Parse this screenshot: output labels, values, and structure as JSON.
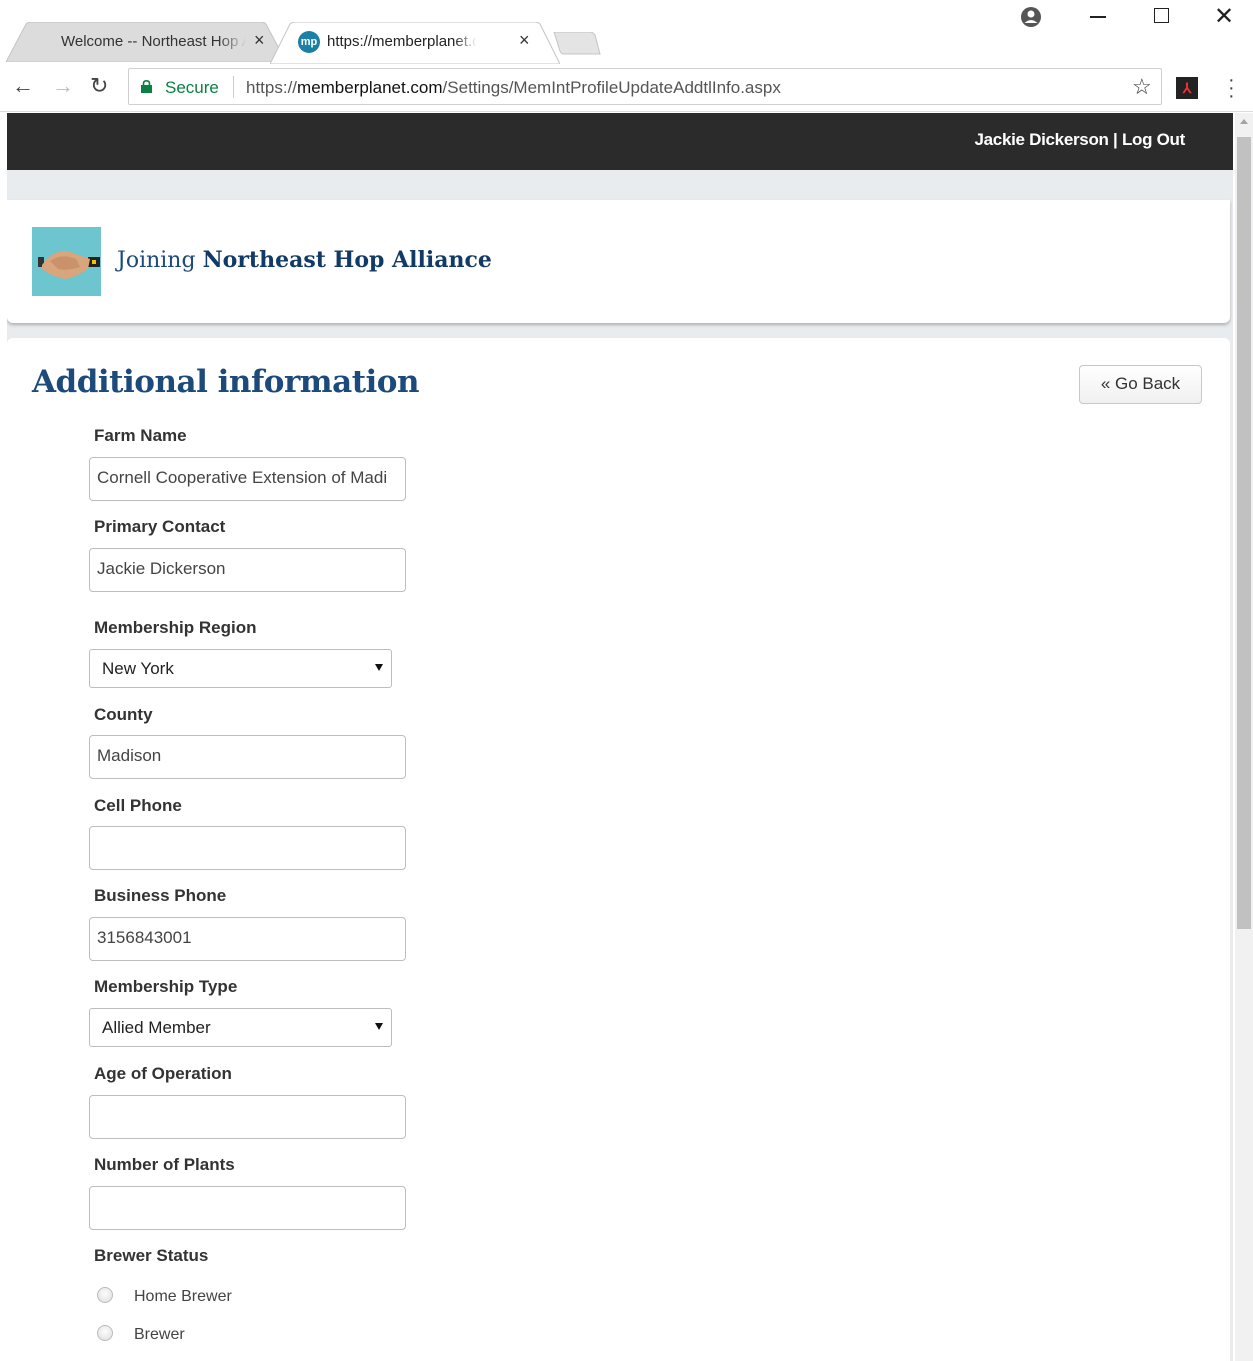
{
  "browser": {
    "tabs": [
      {
        "title": "Welcome -- Northeast Hop Alliance",
        "close": "×"
      },
      {
        "title": "https://memberplanet.com",
        "close": "×",
        "favicon": "mp"
      }
    ],
    "secure_label": "Secure",
    "url_scheme": "https://",
    "url_host": "memberplanet.com",
    "url_path": "/Settings/MemIntProfileUpdateAddtlInfo.aspx",
    "icons": [
      "back-arrow-icon",
      "forward-arrow-icon",
      "reload-icon",
      "lock-icon",
      "star-icon",
      "pdf-extension-icon",
      "kebab-menu-icon",
      "profile-icon",
      "minimize-icon",
      "maximize-icon",
      "close-icon"
    ]
  },
  "topbar": {
    "user_name": "Jackie Dickerson",
    "separator": "|",
    "logout_label": "Log Out"
  },
  "join": {
    "prefix": "Joining",
    "org_name": "Northeast Hop Alliance"
  },
  "form": {
    "title": "Additional information",
    "go_back_label": "« Go Back",
    "fields": {
      "farm_name": {
        "label": "Farm Name",
        "value": "Cornell Cooperative Extension of Madi"
      },
      "primary_contact": {
        "label": "Primary Contact",
        "value": "Jackie Dickerson"
      },
      "membership_region": {
        "label": "Membership Region",
        "value": "New York"
      },
      "county": {
        "label": "County",
        "value": "Madison"
      },
      "cell_phone": {
        "label": "Cell Phone",
        "value": ""
      },
      "business_phone": {
        "label": "Business Phone",
        "value": "3156843001"
      },
      "membership_type": {
        "label": "Membership Type",
        "value": "Allied Member"
      },
      "age_of_operation": {
        "label": "Age of Operation",
        "value": ""
      },
      "number_of_plants": {
        "label": "Number of Plants",
        "value": ""
      },
      "brewer_status": {
        "label": "Brewer Status",
        "options": [
          "Home Brewer",
          "Brewer"
        ]
      }
    }
  },
  "colors": {
    "topbar_bg": "#2b2b2b",
    "title_blue": "#1c4a7a",
    "page_bg": "#e8ecef",
    "secure_green": "#0b8043"
  }
}
